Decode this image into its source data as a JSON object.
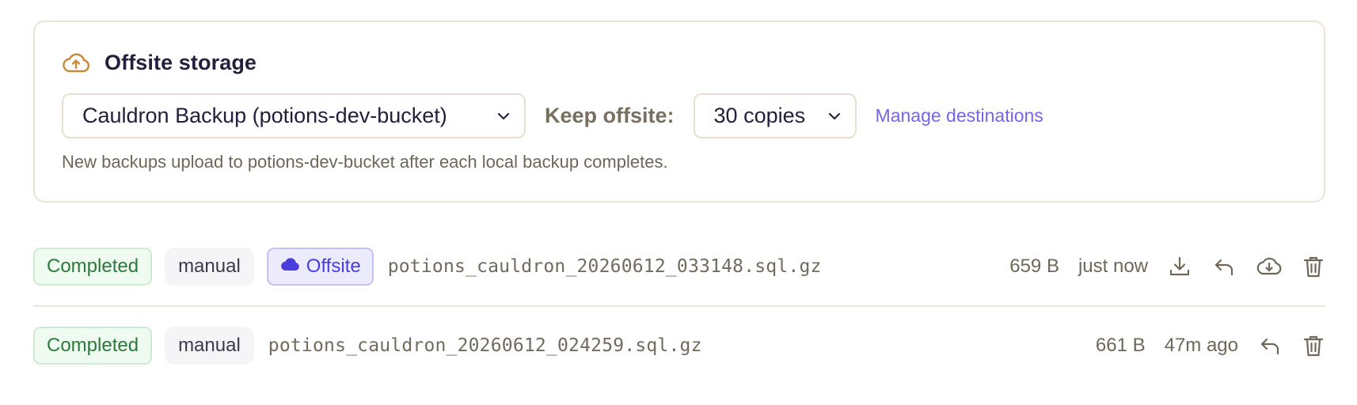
{
  "offsite": {
    "title": "Offsite storage",
    "title_icon": "cloud-upload-icon",
    "destination": {
      "selected": "Cauldron Backup (potions-dev-bucket)"
    },
    "keep_label": "Keep offsite:",
    "keep": {
      "selected": "30 copies"
    },
    "manage_link": "Manage destinations",
    "helper_text": "New backups upload to potions-dev-bucket after each local backup completes."
  },
  "backups": [
    {
      "status": "Completed",
      "trigger": "manual",
      "offsite_badge": "Offsite",
      "filename": "potions_cauldron_20260612_033148.sql.gz",
      "size": "659 B",
      "age": "just now",
      "actions": [
        "download-icon",
        "restore-icon",
        "cloud-download-icon",
        "trash-icon"
      ]
    },
    {
      "status": "Completed",
      "trigger": "manual",
      "filename": "potions_cauldron_20260612_024259.sql.gz",
      "size": "661 B",
      "age": "47m ago",
      "actions": [
        "restore-icon",
        "trash-icon"
      ]
    }
  ],
  "colors": {
    "accent": "#7a63e6",
    "completed_text": "#2c7a3b",
    "offsite_text": "#4b3ddb",
    "icon_orange": "#c8893a",
    "border": "#e9e4d6"
  }
}
